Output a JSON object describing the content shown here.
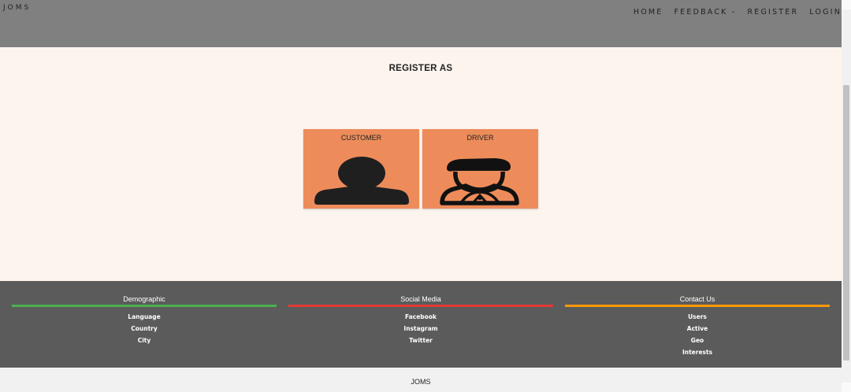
{
  "header": {
    "brand": "JOMS",
    "nav": [
      "HOME",
      "FEEDBACK",
      "REGISTER",
      "LOGIN"
    ],
    "feedback_caret": "-"
  },
  "main": {
    "title": "REGISTER AS",
    "cards": [
      {
        "label": "CUSTOMER",
        "icon": "person-icon"
      },
      {
        "label": "DRIVER",
        "icon": "driver-icon"
      }
    ]
  },
  "footer": {
    "columns": [
      {
        "heading": "Demographic",
        "accent": "#4caf50",
        "links": [
          "Language",
          "Country",
          "City"
        ]
      },
      {
        "heading": "Social Media",
        "accent": "#e53935",
        "links": [
          "Facebook",
          "Instagram",
          "Twitter"
        ]
      },
      {
        "heading": "Contact Us",
        "accent": "#ff9800",
        "links": [
          "Users",
          "Active",
          "Geo",
          "Interests"
        ]
      }
    ],
    "bottom_text": "JOMS"
  },
  "colors": {
    "header_bg": "#808080",
    "page_bg": "#fdf4ee",
    "card_bg": "#ed8c5a",
    "footer_bg": "#5b5b5b"
  }
}
